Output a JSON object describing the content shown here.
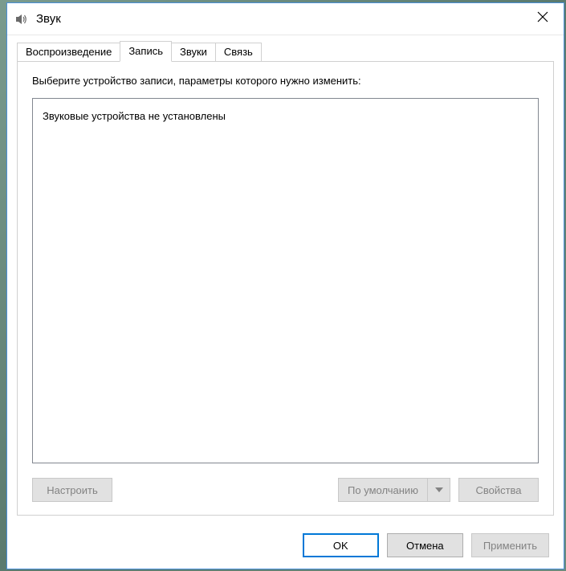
{
  "window": {
    "title": "Звук"
  },
  "tabs": {
    "playback": "Воспроизведение",
    "recording": "Запись",
    "sounds": "Звуки",
    "communications": "Связь"
  },
  "panel": {
    "instruction": "Выберите устройство записи, параметры которого нужно изменить:",
    "empty_message": "Звуковые устройства не установлены",
    "configure_label": "Настроить",
    "default_label": "По умолчанию",
    "properties_label": "Свойства"
  },
  "dialog": {
    "ok_label": "OK",
    "cancel_label": "Отмена",
    "apply_label": "Применить"
  }
}
